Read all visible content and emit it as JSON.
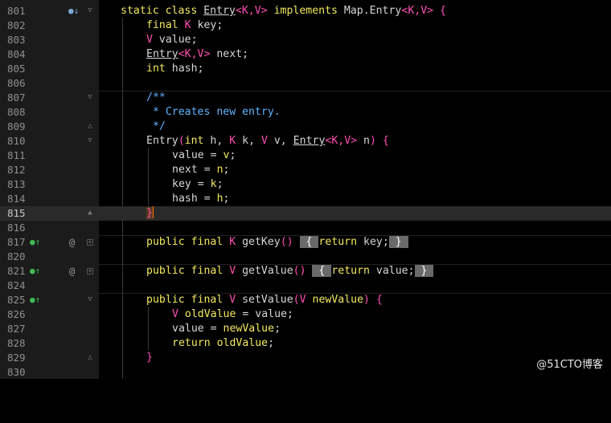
{
  "editor": {
    "lines": [
      {
        "n": "801",
        "code": "static class Entry<K,V> implements Map.Entry<K,V> {"
      },
      {
        "n": "802",
        "code": "final K key;"
      },
      {
        "n": "803",
        "code": "V value;"
      },
      {
        "n": "804",
        "code": "Entry<K,V> next;"
      },
      {
        "n": "805",
        "code": "int hash;"
      },
      {
        "n": "806",
        "code": ""
      },
      {
        "n": "807",
        "code": "/**"
      },
      {
        "n": "808",
        "code": " * Creates new entry."
      },
      {
        "n": "809",
        "code": " */"
      },
      {
        "n": "810",
        "code": "Entry(int h, K k, V v, Entry<K,V> n) {"
      },
      {
        "n": "811",
        "code": "value = v;"
      },
      {
        "n": "812",
        "code": "next = n;"
      },
      {
        "n": "813",
        "code": "key = k;"
      },
      {
        "n": "814",
        "code": "hash = h;"
      },
      {
        "n": "815",
        "code": "}"
      },
      {
        "n": "816",
        "code": ""
      },
      {
        "n": "817",
        "code": "public final K getKey() { return key; }"
      },
      {
        "n": "820",
        "code": ""
      },
      {
        "n": "821",
        "code": "public final V getValue() { return value; }"
      },
      {
        "n": "824",
        "code": ""
      },
      {
        "n": "825",
        "code": "public final V setValue(V newValue) {"
      },
      {
        "n": "826",
        "code": "V oldValue = value;"
      },
      {
        "n": "827",
        "code": "value = newValue;"
      },
      {
        "n": "828",
        "code": "return oldValue;"
      },
      {
        "n": "829",
        "code": "}"
      },
      {
        "n": "830",
        "code": ""
      }
    ]
  },
  "watermark": "@51CTO博客",
  "colors": {
    "background": "#000000",
    "keyword": "#f2e85e",
    "type_param": "#ff4fb1",
    "comment": "#5fb3ff",
    "current_line": "#2a2a2a"
  }
}
